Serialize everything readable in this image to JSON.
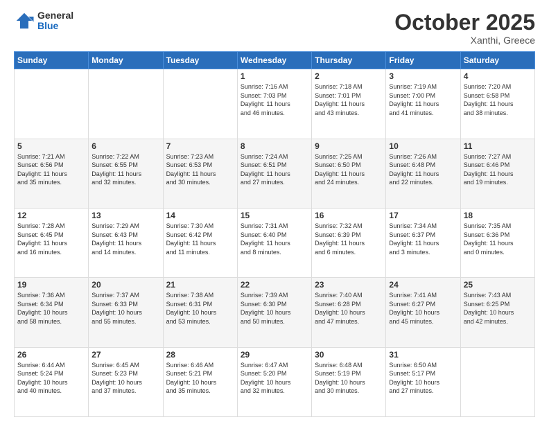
{
  "header": {
    "logo": {
      "general": "General",
      "blue": "Blue"
    },
    "title": "October 2025",
    "location": "Xanthi, Greece"
  },
  "weekdays": [
    "Sunday",
    "Monday",
    "Tuesday",
    "Wednesday",
    "Thursday",
    "Friday",
    "Saturday"
  ],
  "weeks": [
    [
      {
        "day": "",
        "info": ""
      },
      {
        "day": "",
        "info": ""
      },
      {
        "day": "",
        "info": ""
      },
      {
        "day": "1",
        "info": "Sunrise: 7:16 AM\nSunset: 7:03 PM\nDaylight: 11 hours\nand 46 minutes."
      },
      {
        "day": "2",
        "info": "Sunrise: 7:18 AM\nSunset: 7:01 PM\nDaylight: 11 hours\nand 43 minutes."
      },
      {
        "day": "3",
        "info": "Sunrise: 7:19 AM\nSunset: 7:00 PM\nDaylight: 11 hours\nand 41 minutes."
      },
      {
        "day": "4",
        "info": "Sunrise: 7:20 AM\nSunset: 6:58 PM\nDaylight: 11 hours\nand 38 minutes."
      }
    ],
    [
      {
        "day": "5",
        "info": "Sunrise: 7:21 AM\nSunset: 6:56 PM\nDaylight: 11 hours\nand 35 minutes."
      },
      {
        "day": "6",
        "info": "Sunrise: 7:22 AM\nSunset: 6:55 PM\nDaylight: 11 hours\nand 32 minutes."
      },
      {
        "day": "7",
        "info": "Sunrise: 7:23 AM\nSunset: 6:53 PM\nDaylight: 11 hours\nand 30 minutes."
      },
      {
        "day": "8",
        "info": "Sunrise: 7:24 AM\nSunset: 6:51 PM\nDaylight: 11 hours\nand 27 minutes."
      },
      {
        "day": "9",
        "info": "Sunrise: 7:25 AM\nSunset: 6:50 PM\nDaylight: 11 hours\nand 24 minutes."
      },
      {
        "day": "10",
        "info": "Sunrise: 7:26 AM\nSunset: 6:48 PM\nDaylight: 11 hours\nand 22 minutes."
      },
      {
        "day": "11",
        "info": "Sunrise: 7:27 AM\nSunset: 6:46 PM\nDaylight: 11 hours\nand 19 minutes."
      }
    ],
    [
      {
        "day": "12",
        "info": "Sunrise: 7:28 AM\nSunset: 6:45 PM\nDaylight: 11 hours\nand 16 minutes."
      },
      {
        "day": "13",
        "info": "Sunrise: 7:29 AM\nSunset: 6:43 PM\nDaylight: 11 hours\nand 14 minutes."
      },
      {
        "day": "14",
        "info": "Sunrise: 7:30 AM\nSunset: 6:42 PM\nDaylight: 11 hours\nand 11 minutes."
      },
      {
        "day": "15",
        "info": "Sunrise: 7:31 AM\nSunset: 6:40 PM\nDaylight: 11 hours\nand 8 minutes."
      },
      {
        "day": "16",
        "info": "Sunrise: 7:32 AM\nSunset: 6:39 PM\nDaylight: 11 hours\nand 6 minutes."
      },
      {
        "day": "17",
        "info": "Sunrise: 7:34 AM\nSunset: 6:37 PM\nDaylight: 11 hours\nand 3 minutes."
      },
      {
        "day": "18",
        "info": "Sunrise: 7:35 AM\nSunset: 6:36 PM\nDaylight: 11 hours\nand 0 minutes."
      }
    ],
    [
      {
        "day": "19",
        "info": "Sunrise: 7:36 AM\nSunset: 6:34 PM\nDaylight: 10 hours\nand 58 minutes."
      },
      {
        "day": "20",
        "info": "Sunrise: 7:37 AM\nSunset: 6:33 PM\nDaylight: 10 hours\nand 55 minutes."
      },
      {
        "day": "21",
        "info": "Sunrise: 7:38 AM\nSunset: 6:31 PM\nDaylight: 10 hours\nand 53 minutes."
      },
      {
        "day": "22",
        "info": "Sunrise: 7:39 AM\nSunset: 6:30 PM\nDaylight: 10 hours\nand 50 minutes."
      },
      {
        "day": "23",
        "info": "Sunrise: 7:40 AM\nSunset: 6:28 PM\nDaylight: 10 hours\nand 47 minutes."
      },
      {
        "day": "24",
        "info": "Sunrise: 7:41 AM\nSunset: 6:27 PM\nDaylight: 10 hours\nand 45 minutes."
      },
      {
        "day": "25",
        "info": "Sunrise: 7:43 AM\nSunset: 6:25 PM\nDaylight: 10 hours\nand 42 minutes."
      }
    ],
    [
      {
        "day": "26",
        "info": "Sunrise: 6:44 AM\nSunset: 5:24 PM\nDaylight: 10 hours\nand 40 minutes."
      },
      {
        "day": "27",
        "info": "Sunrise: 6:45 AM\nSunset: 5:23 PM\nDaylight: 10 hours\nand 37 minutes."
      },
      {
        "day": "28",
        "info": "Sunrise: 6:46 AM\nSunset: 5:21 PM\nDaylight: 10 hours\nand 35 minutes."
      },
      {
        "day": "29",
        "info": "Sunrise: 6:47 AM\nSunset: 5:20 PM\nDaylight: 10 hours\nand 32 minutes."
      },
      {
        "day": "30",
        "info": "Sunrise: 6:48 AM\nSunset: 5:19 PM\nDaylight: 10 hours\nand 30 minutes."
      },
      {
        "day": "31",
        "info": "Sunrise: 6:50 AM\nSunset: 5:17 PM\nDaylight: 10 hours\nand 27 minutes."
      },
      {
        "day": "",
        "info": ""
      }
    ]
  ]
}
